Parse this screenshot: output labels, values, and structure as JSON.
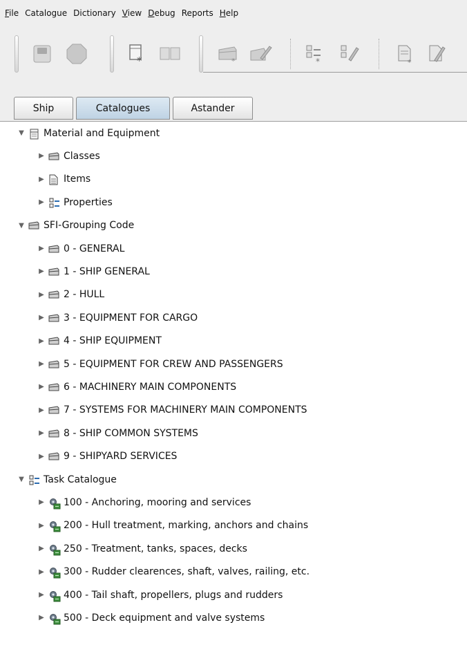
{
  "menubar": {
    "items": [
      {
        "mnemonic": "F",
        "rest": "ile"
      },
      {
        "mnemonic": "",
        "rest": "Catalogue"
      },
      {
        "mnemonic": "",
        "rest": "Dictionary"
      },
      {
        "mnemonic": "V",
        "rest": "iew"
      },
      {
        "mnemonic": "D",
        "rest": "ebug"
      },
      {
        "mnemonic": "",
        "rest": "Reports"
      },
      {
        "mnemonic": "H",
        "rest": "elp"
      }
    ]
  },
  "toolbar": {
    "buttons": [
      "save-icon",
      "stop-icon",
      "new-catalogue-icon",
      "book-icon",
      "folder-icon",
      "edit-folder-icon",
      "new-properties-icon",
      "edit-properties-icon",
      "new-item-icon",
      "edit-item-icon"
    ]
  },
  "tabs": [
    {
      "label": "Ship"
    },
    {
      "label": "Catalogues"
    },
    {
      "label": "Astander"
    }
  ],
  "active_tab": "Catalogues",
  "tree": {
    "nodes": [
      {
        "label": "Material and Equipment",
        "expanded": true,
        "icon": "catalogue-icon"
      },
      {
        "label": "Classes",
        "expanded": false,
        "icon": "folder-icon"
      },
      {
        "label": "Items",
        "expanded": false,
        "icon": "document-icon"
      },
      {
        "label": "Properties",
        "expanded": false,
        "icon": "properties-icon"
      },
      {
        "label": "SFI-Grouping Code",
        "expanded": true,
        "icon": "folder-icon"
      },
      {
        "label": "0 - GENERAL",
        "expanded": false,
        "icon": "folder-icon"
      },
      {
        "label": "1 -  SHIP GENERAL",
        "expanded": false,
        "icon": "folder-icon"
      },
      {
        "label": "2 -  HULL",
        "expanded": false,
        "icon": "folder-icon"
      },
      {
        "label": "3 -  EQUIPMENT FOR CARGO",
        "expanded": false,
        "icon": "folder-icon"
      },
      {
        "label": "4 -  SHIP EQUIPMENT",
        "expanded": false,
        "icon": "folder-icon"
      },
      {
        "label": "5 -  EQUIPMENT FOR CREW AND PASSENGERS",
        "expanded": false,
        "icon": "folder-icon"
      },
      {
        "label": "6 -  MACHINERY MAIN COMPONENTS",
        "expanded": false,
        "icon": "folder-icon"
      },
      {
        "label": "7 -  SYSTEMS FOR MACHINERY MAIN COMPONENTS",
        "expanded": false,
        "icon": "folder-icon"
      },
      {
        "label": "8 -  SHIP COMMON SYSTEMS",
        "expanded": false,
        "icon": "folder-icon"
      },
      {
        "label": "9 - SHIPYARD SERVICES",
        "expanded": false,
        "icon": "folder-icon"
      },
      {
        "label": "Task Catalogue",
        "expanded": true,
        "icon": "properties-icon"
      },
      {
        "label": "100 - Anchoring, mooring and services",
        "expanded": false,
        "icon": "task-icon"
      },
      {
        "label": "200 - Hull treatment, marking,  anchors and chains",
        "expanded": false,
        "icon": "task-icon"
      },
      {
        "label": "250 - Treatment, tanks,  spaces,  decks",
        "expanded": false,
        "icon": "task-icon"
      },
      {
        "label": "300 - Rudder clearences, shaft, valves,  railing, etc.",
        "expanded": false,
        "icon": "task-icon"
      },
      {
        "label": "400 - Tail shaft, propellers,  plugs  and rudders",
        "expanded": false,
        "icon": "task-icon"
      },
      {
        "label": "500 - Deck equipment and valve systems",
        "expanded": false,
        "icon": "task-icon"
      }
    ]
  }
}
